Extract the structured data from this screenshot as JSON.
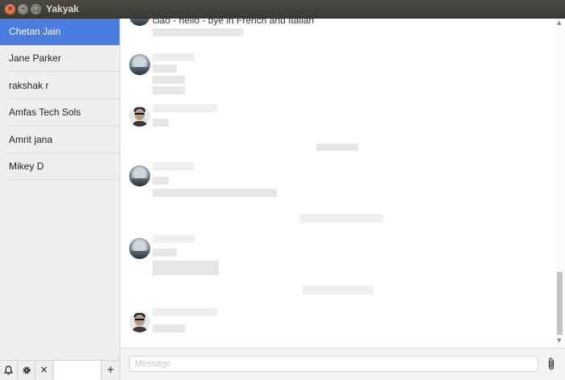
{
  "window": {
    "title": "Yakyak",
    "close_glyph": "×",
    "minimize_glyph": "–",
    "maximize_glyph": "□"
  },
  "sidebar": {
    "contacts": [
      {
        "name": "Chetan Jain",
        "active": true
      },
      {
        "name": "Jane Parker",
        "active": false
      },
      {
        "name": "rakshak r",
        "active": false
      },
      {
        "name": "Amfas Tech Sols",
        "active": false
      },
      {
        "name": "Amrit jana",
        "active": false
      },
      {
        "name": "Mikey D",
        "active": false
      }
    ],
    "footer": {
      "bell_icon": "bell-icon",
      "gear_icon": "gear-icon",
      "close_glyph": "×",
      "add_glyph": "+"
    }
  },
  "chat": {
    "first_message_text": "ciao - hello - bye in French and Italian"
  },
  "composer": {
    "placeholder": "Message",
    "attach_icon": "paperclip-icon"
  },
  "colors": {
    "accent": "#4a7ddf",
    "titlebar": "#3c3b37",
    "close_button": "#e05524"
  }
}
